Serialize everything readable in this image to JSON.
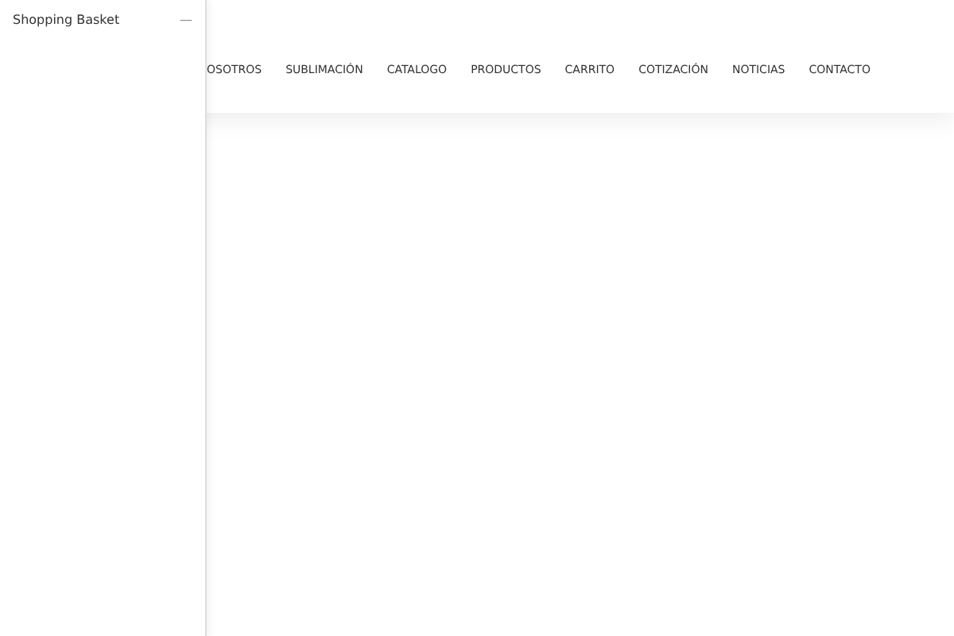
{
  "side_panel": {
    "title": "Shopping Basket",
    "close_symbol": "—"
  },
  "nav": {
    "items": [
      {
        "label": "OSOTROS"
      },
      {
        "label": "SUBLIMACIÓN"
      },
      {
        "label": "CATALOGO"
      },
      {
        "label": "PRODUCTOS"
      },
      {
        "label": "CARRITO"
      },
      {
        "label": "COTIZACIÓN"
      },
      {
        "label": "NOTICIAS"
      },
      {
        "label": "CONTACTO"
      }
    ]
  }
}
